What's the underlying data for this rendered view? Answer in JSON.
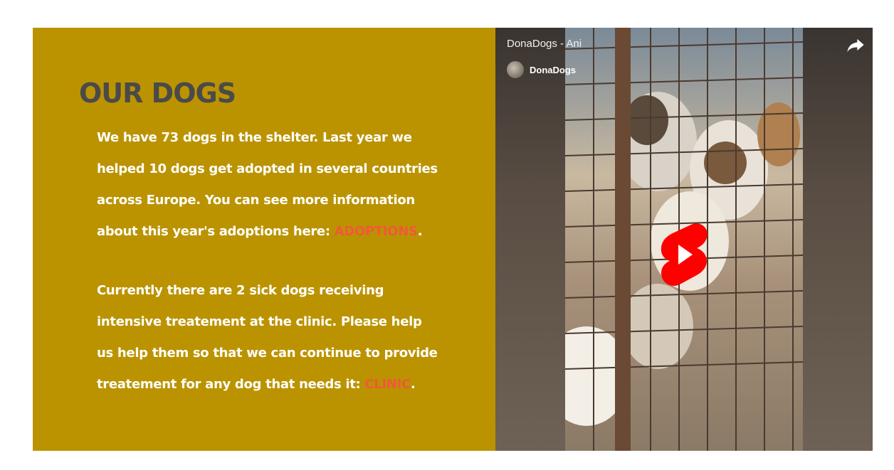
{
  "section": {
    "title": "OUR DOGS",
    "para1": {
      "text": "We have 73 dogs in the shelter. Last year we helped 10 dogs get adopted in several countries across Europe. You can see more information about this year's adoptions here: ",
      "link": "ADOPTIONS",
      "end": "."
    },
    "para2": {
      "text": "Currently there are 2 sick dogs receiving intensive treatement at the clinic. Please help us help them so that we can continue to provide treatement for any dog that needs it: ",
      "link": "CLINIC",
      "end": "."
    },
    "colors": {
      "panel": "#bb9300",
      "title": "#4a4a4a",
      "link": "#f2583a"
    }
  },
  "video": {
    "title": "DonaDogs - Ani",
    "channel": "DonaDogs",
    "icons": {
      "share": "share-icon",
      "play": "youtube-shorts-play-icon",
      "avatar": "channel-avatar"
    },
    "colors": {
      "play": "#ff0000"
    }
  }
}
